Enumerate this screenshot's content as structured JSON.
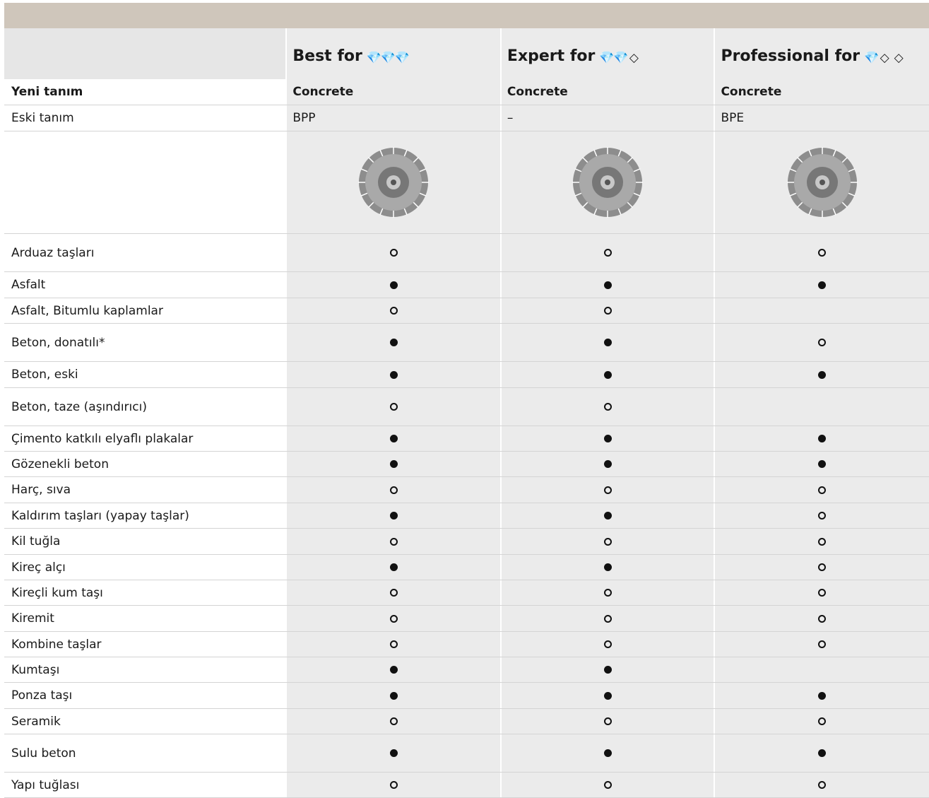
{
  "header": {
    "columns": [
      {
        "label": "Best for",
        "gems": [
          "filled",
          "filled",
          "filled"
        ]
      },
      {
        "label": "Expert for",
        "gems": [
          "filled",
          "filled",
          "outline"
        ]
      },
      {
        "label": "Professional for",
        "gems": [
          "filled",
          "outline",
          "outline"
        ]
      }
    ]
  },
  "rows_meta": {
    "new_name": {
      "label": "Yeni tanım",
      "values": [
        "Concrete",
        "Concrete",
        "Concrete"
      ]
    },
    "old_name": {
      "label": "Eski tanım",
      "values": [
        "BPP",
        "–",
        "BPE"
      ]
    }
  },
  "product_images": [
    "diamond-blade-image",
    "diamond-blade-image",
    "diamond-blade-image"
  ],
  "legend_symbols": {
    "filled": "●",
    "open": "○",
    "empty": ""
  },
  "materials": [
    {
      "name": "Arduaz taşları",
      "values": [
        "open",
        "open",
        "open"
      ]
    },
    {
      "name": "Asfalt",
      "values": [
        "filled",
        "filled",
        "filled"
      ]
    },
    {
      "name": "Asfalt, Bitumlu kaplamlar",
      "values": [
        "open",
        "open",
        "empty"
      ]
    },
    {
      "name": "Beton, donatılı*",
      "values": [
        "filled",
        "filled",
        "open"
      ]
    },
    {
      "name": "Beton, eski",
      "values": [
        "filled",
        "filled",
        "filled"
      ]
    },
    {
      "name": "Beton, taze (aşındırıcı)",
      "values": [
        "open",
        "open",
        "empty"
      ]
    },
    {
      "name": "Çimento katkılı elyaflı plakalar",
      "values": [
        "filled",
        "filled",
        "filled"
      ]
    },
    {
      "name": "Gözenekli beton",
      "values": [
        "filled",
        "filled",
        "filled"
      ]
    },
    {
      "name": "Harç, sıva",
      "values": [
        "open",
        "open",
        "open"
      ]
    },
    {
      "name": "Kaldırım taşları (yapay taşlar)",
      "values": [
        "filled",
        "filled",
        "open"
      ]
    },
    {
      "name": "Kil tuğla",
      "values": [
        "open",
        "open",
        "open"
      ]
    },
    {
      "name": "Kireç alçı",
      "values": [
        "filled",
        "filled",
        "open"
      ]
    },
    {
      "name": "Kireçli kum taşı",
      "values": [
        "open",
        "open",
        "open"
      ]
    },
    {
      "name": "Kiremit",
      "values": [
        "open",
        "open",
        "open"
      ]
    },
    {
      "name": "Kombine taşlar",
      "values": [
        "open",
        "open",
        "open"
      ]
    },
    {
      "name": "Kumtaşı",
      "values": [
        "filled",
        "filled",
        "empty"
      ]
    },
    {
      "name": "Ponza taşı",
      "values": [
        "filled",
        "filled",
        "filled"
      ]
    },
    {
      "name": "Seramik",
      "values": [
        "open",
        "open",
        "open"
      ]
    },
    {
      "name": "Sulu beton",
      "values": [
        "filled",
        "filled",
        "filled"
      ]
    },
    {
      "name": "Yapı tuğlası",
      "values": [
        "open",
        "open",
        "open"
      ]
    }
  ]
}
